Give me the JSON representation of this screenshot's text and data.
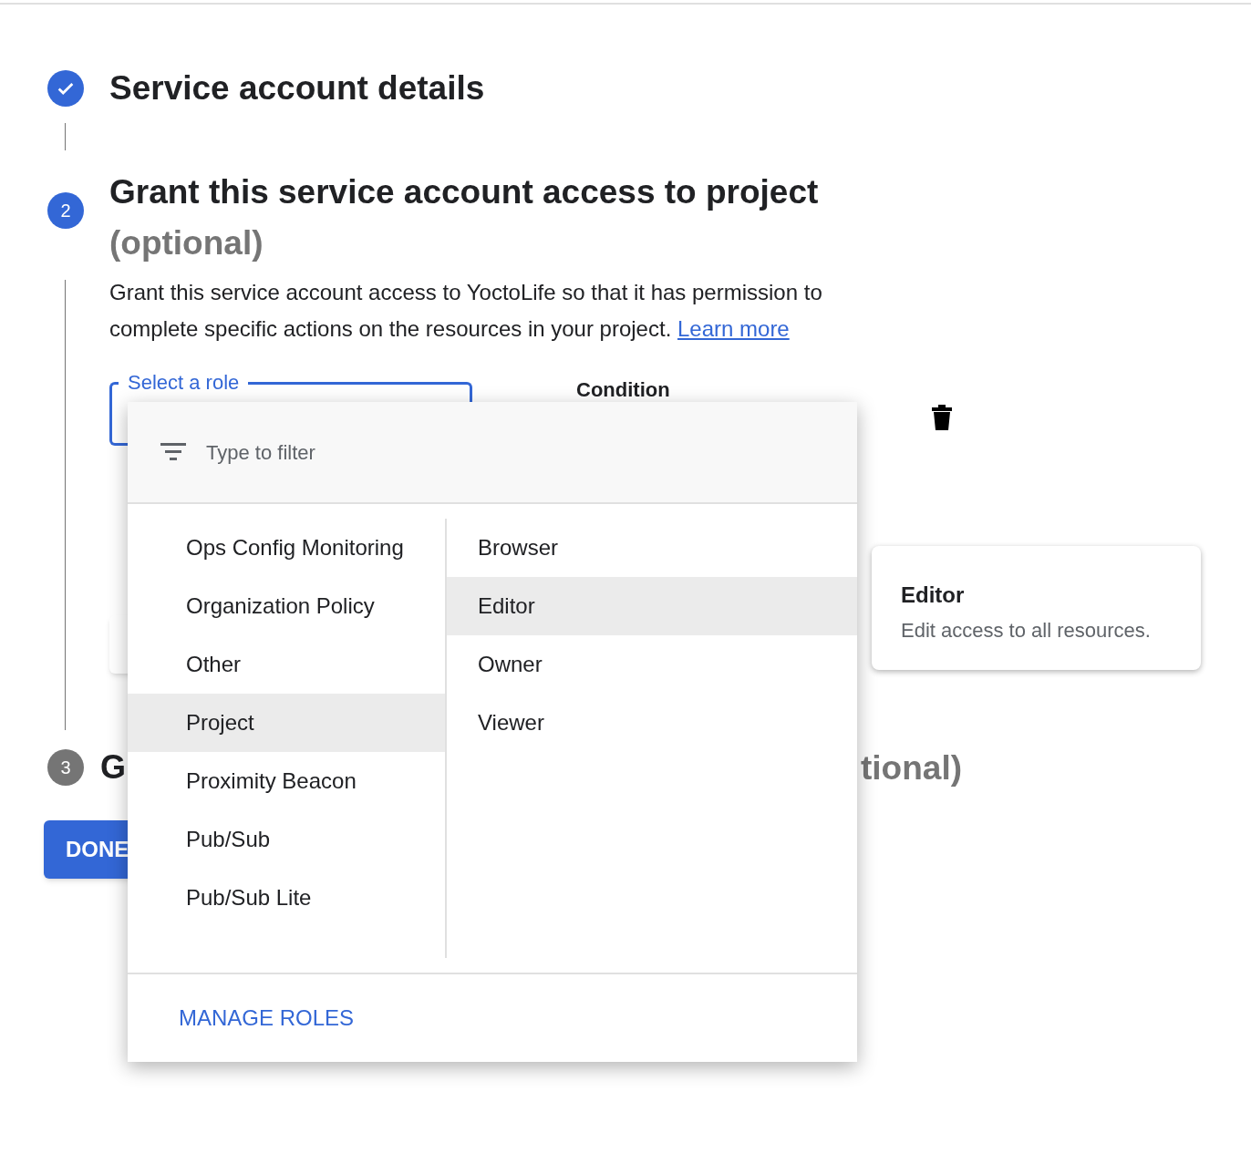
{
  "steps": [
    {
      "kind": "done",
      "title": "Service account details"
    },
    {
      "kind": "active",
      "number": "2",
      "title": "Grant this service account access to project",
      "optional": "(optional)",
      "description": "Grant this service account access to YoctoLife so that it has permission to complete specific actions on the resources in your project.",
      "link": "Learn more"
    },
    {
      "kind": "pending",
      "number": "3",
      "title_start": "G",
      "title_end": "tional)"
    }
  ],
  "role_field": {
    "label": "Select a role"
  },
  "condition_label": "Condition",
  "done_button": "DONE",
  "menu": {
    "filter_placeholder": "Type to filter",
    "categories": [
      {
        "label": "Ops Config Monitoring",
        "selected": false
      },
      {
        "label": "Organization Policy",
        "selected": false
      },
      {
        "label": "Other",
        "selected": false
      },
      {
        "label": "Project",
        "selected": true
      },
      {
        "label": "Proximity Beacon",
        "selected": false
      },
      {
        "label": "Pub/Sub",
        "selected": false
      },
      {
        "label": "Pub/Sub Lite",
        "selected": false
      }
    ],
    "roles": [
      {
        "label": "Browser",
        "selected": false
      },
      {
        "label": "Editor",
        "selected": true
      },
      {
        "label": "Owner",
        "selected": false
      },
      {
        "label": "Viewer",
        "selected": false
      }
    ],
    "footer_button": "MANAGE ROLES"
  },
  "tooltip": {
    "title": "Editor",
    "description": "Edit access to all resources."
  }
}
